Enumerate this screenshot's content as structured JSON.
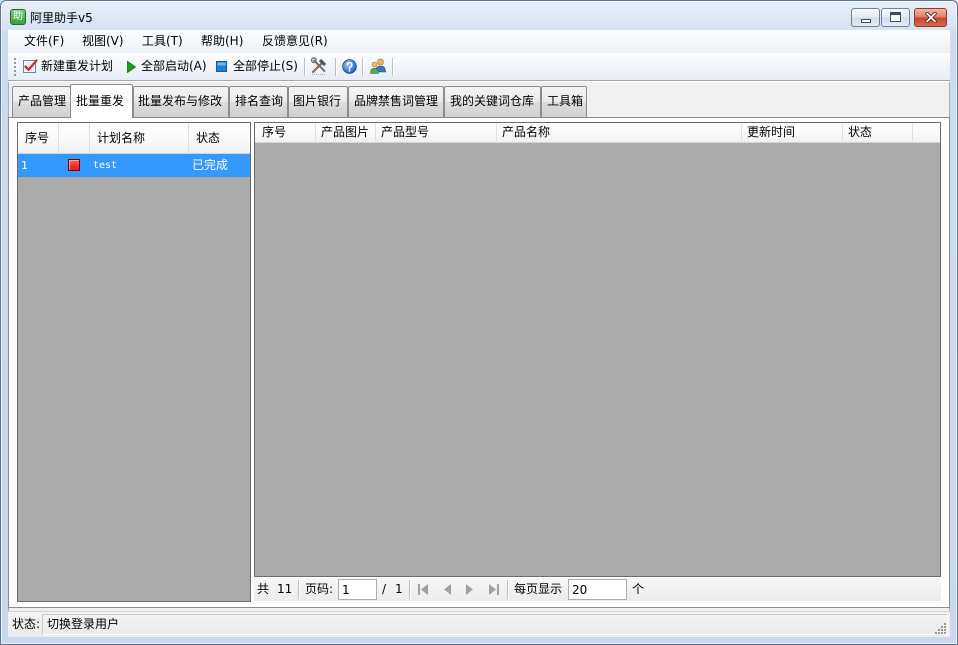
{
  "window": {
    "title": "阿里助手v5",
    "icon_glyph": "助",
    "icon": "app-logo-icon",
    "controls": [
      "minimize-icon",
      "maximize-icon",
      "close-icon"
    ]
  },
  "menu": {
    "items": [
      "文件(F)",
      "视图(V)",
      "工具(T)",
      "帮助(H)",
      "反馈意见(R)"
    ]
  },
  "toolbar": {
    "new_plan": {
      "label": "新建重发计划",
      "icon": "new-plan-check-icon"
    },
    "start_all": {
      "label": "全部启动(A)",
      "icon": "play-icon"
    },
    "stop_all": {
      "label": "全部停止(S)",
      "icon": "stop-icon"
    },
    "extra_icons": [
      "tools-icon",
      "help-icon",
      "switch-user-icon"
    ]
  },
  "tabs": [
    {
      "label": "产品管理",
      "active": false
    },
    {
      "label": "批量重发",
      "active": true
    },
    {
      "label": "批量发布与修改",
      "active": false
    },
    {
      "label": "排名查询",
      "active": false
    },
    {
      "label": "图片银行",
      "active": false
    },
    {
      "label": "品牌禁售词管理",
      "active": false
    },
    {
      "label": "我的关键词仓库",
      "active": false
    },
    {
      "label": "工具箱",
      "active": false
    }
  ],
  "plan_grid": {
    "columns": [
      "序号",
      "",
      "计划名称",
      "状态"
    ],
    "rows": [
      {
        "index": "1",
        "status_icon": "red-square-icon",
        "name": "test",
        "status": "已完成",
        "selected": true
      }
    ]
  },
  "product_grid": {
    "columns": [
      "序号",
      "产品图片",
      "产品型号",
      "产品名称",
      "更新时间",
      "状态"
    ],
    "rows": []
  },
  "pager": {
    "total_label": "共",
    "total": "11",
    "page_label": "页码:",
    "page": "1",
    "page_separator": "/",
    "page_count": "1",
    "nav_icons": [
      "first-page-icon",
      "prev-page-icon",
      "next-page-icon",
      "last-page-icon"
    ],
    "per_page_label": "每页显示",
    "per_page": "20",
    "per_page_unit": "个"
  },
  "status_bar": {
    "label": "状态:",
    "text": "切换登录用户"
  },
  "colors": {
    "selection": "#3399ff",
    "grid_background": "#ababab",
    "app_icon": "#3a9f3a",
    "close_button": "#c7452f",
    "play_icon": "#1e9e1e",
    "stop_icon": "#1c7fd6",
    "status_icon": "#e01b1b",
    "disabled_icon": "#a0a0a0"
  }
}
